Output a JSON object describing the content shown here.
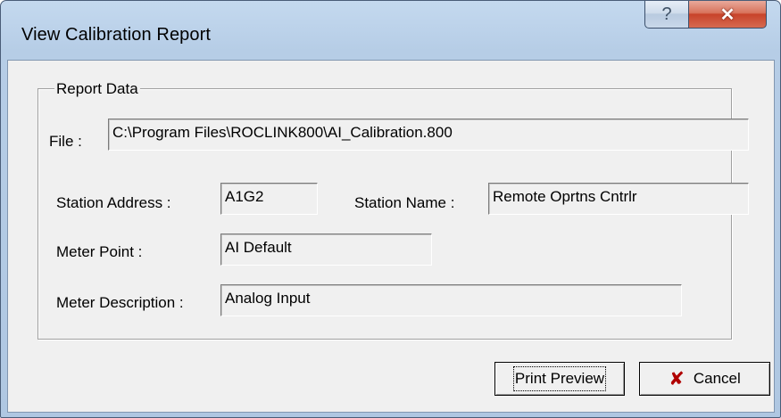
{
  "window": {
    "title": "View Calibration Report",
    "help_glyph": "?",
    "close_glyph": "✕"
  },
  "group": {
    "label": "Report Data"
  },
  "fields": {
    "file_label": "File :",
    "file_value": "C:\\Program Files\\ROCLINK800\\AI_Calibration.800",
    "station_address_label": "Station Address :",
    "station_address_value": "A1G2",
    "station_name_label": "Station Name :",
    "station_name_value": "Remote Oprtns Cntrlr",
    "meter_point_label": "Meter Point :",
    "meter_point_value": "AI Default",
    "meter_description_label": "Meter Description :",
    "meter_description_value": "Analog Input"
  },
  "buttons": {
    "print_preview_label": "Print Preview",
    "cancel_label": "Cancel",
    "cancel_glyph": "✘"
  },
  "icons": {
    "help": "help-icon",
    "close": "close-icon",
    "cancel": "cancel-x-icon"
  }
}
